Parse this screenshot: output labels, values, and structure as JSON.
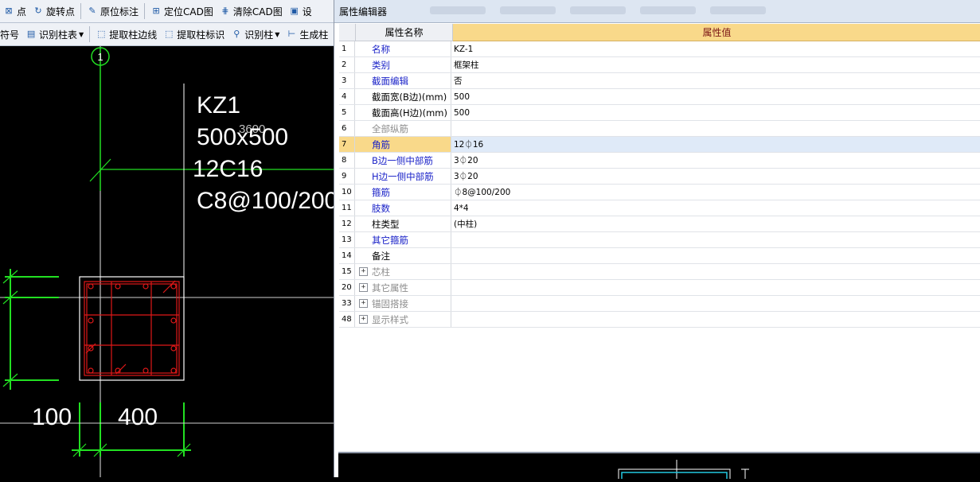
{
  "toolbar_row1": {
    "point_label": "点",
    "rotate_point_label": "旋转点",
    "origin_label_label": "原位标注",
    "locate_cad_label": "定位CAD图",
    "clear_cad_label": "清除CAD图",
    "truncated_label": "设"
  },
  "toolbar_row2": {
    "symbol_label": "符号",
    "recognize_table_label": "识别柱表",
    "extract_edge_label": "提取柱边线",
    "extract_mark_label": "提取柱标识",
    "recognize_col_label": "识别柱",
    "generate_col_label": "生成柱"
  },
  "cad": {
    "axis_number": "1",
    "dim_3600": "3600",
    "col_name": "KZ1",
    "col_size": "500x500",
    "col_rebar": "12C16",
    "col_stirrup": "C8@100/200",
    "dim_100": "100",
    "dim_400": "400"
  },
  "panel": {
    "title": "属性编辑器",
    "header_name": "属性名称",
    "header_value": "属性值"
  },
  "rows": [
    {
      "num": "1",
      "name": "名称",
      "value": "KZ-1",
      "style": "blue"
    },
    {
      "num": "2",
      "name": "类别",
      "value": "框架柱",
      "style": "blue"
    },
    {
      "num": "3",
      "name": "截面编辑",
      "value": "否",
      "style": "blue"
    },
    {
      "num": "4",
      "name": "截面宽(B边)(mm)",
      "value": "500",
      "style": "black"
    },
    {
      "num": "5",
      "name": "截面高(H边)(mm)",
      "value": "500",
      "style": "black"
    },
    {
      "num": "6",
      "name": "全部纵筋",
      "value": "",
      "style": "gray"
    },
    {
      "num": "7",
      "name": "角筋",
      "value": "12⏀16",
      "style": "sel"
    },
    {
      "num": "8",
      "name": "B边一侧中部筋",
      "value": "3⏀20",
      "style": "blue"
    },
    {
      "num": "9",
      "name": "H边一侧中部筋",
      "value": "3⏀20",
      "style": "blue"
    },
    {
      "num": "10",
      "name": "箍筋",
      "value": "⏀8@100/200",
      "style": "blue"
    },
    {
      "num": "11",
      "name": "肢数",
      "value": "4*4",
      "style": "blue"
    },
    {
      "num": "12",
      "name": "柱类型",
      "value": "(中柱)",
      "style": "black"
    },
    {
      "num": "13",
      "name": "其它箍筋",
      "value": "",
      "style": "blue"
    },
    {
      "num": "14",
      "name": "备注",
      "value": "",
      "style": "black"
    },
    {
      "num": "15",
      "name": "芯柱",
      "value": "",
      "style": "gray",
      "expand": "+"
    },
    {
      "num": "20",
      "name": "其它属性",
      "value": "",
      "style": "gray",
      "expand": "+"
    },
    {
      "num": "33",
      "name": "锚固搭接",
      "value": "",
      "style": "gray",
      "expand": "+"
    },
    {
      "num": "48",
      "name": "显示样式",
      "value": "",
      "style": "gray",
      "expand": "+"
    }
  ],
  "colors": {
    "cad_background": "#000000",
    "grid_line": "#22e022",
    "rebar": "#e01818",
    "selected_row": "#f9d98a",
    "name_text": "#1a22c8"
  }
}
